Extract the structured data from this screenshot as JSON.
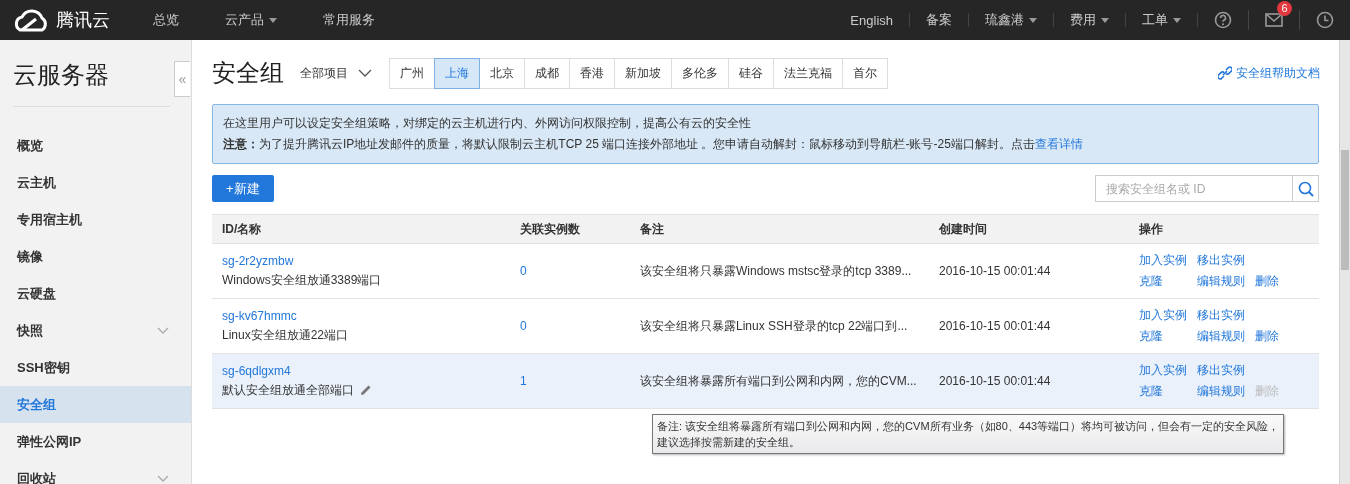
{
  "topbar": {
    "logo": "腾讯云",
    "nav": [
      {
        "label": "总览",
        "dropdown": false
      },
      {
        "label": "云产品",
        "dropdown": true
      },
      {
        "label": "常用服务",
        "dropdown": false
      }
    ],
    "right": [
      {
        "label": "English",
        "dropdown": false
      },
      {
        "label": "备案",
        "dropdown": false
      },
      {
        "label": "琉鑫港",
        "dropdown": true
      },
      {
        "label": "费用",
        "dropdown": true
      },
      {
        "label": "工单",
        "dropdown": true
      }
    ],
    "mail_badge": "6"
  },
  "sidebar": {
    "title": "云服务器",
    "collapse": "«",
    "items": [
      {
        "label": "概览",
        "selected": false,
        "expandable": false
      },
      {
        "label": "云主机",
        "selected": false,
        "expandable": false
      },
      {
        "label": "专用宿主机",
        "selected": false,
        "expandable": false
      },
      {
        "label": "镜像",
        "selected": false,
        "expandable": false
      },
      {
        "label": "云硬盘",
        "selected": false,
        "expandable": false
      },
      {
        "label": "快照",
        "selected": false,
        "expandable": true
      },
      {
        "label": "SSH密钥",
        "selected": false,
        "expandable": false
      },
      {
        "label": "安全组",
        "selected": true,
        "expandable": false
      },
      {
        "label": "弹性公网IP",
        "selected": false,
        "expandable": false
      },
      {
        "label": "回收站",
        "selected": false,
        "expandable": true
      }
    ]
  },
  "page": {
    "title": "安全组",
    "project": "全部项目",
    "regions": [
      {
        "label": "广州",
        "selected": false
      },
      {
        "label": "上海",
        "selected": true
      },
      {
        "label": "北京",
        "selected": false
      },
      {
        "label": "成都",
        "selected": false
      },
      {
        "label": "香港",
        "selected": false
      },
      {
        "label": "新加坡",
        "selected": false
      },
      {
        "label": "多伦多",
        "selected": false
      },
      {
        "label": "硅谷",
        "selected": false
      },
      {
        "label": "法兰克福",
        "selected": false
      },
      {
        "label": "首尔",
        "selected": false
      }
    ],
    "help_link": "安全组帮助文档",
    "notice": {
      "line1": "在这里用户可以设定安全组策略，对绑定的云主机进行内、外网访问权限控制，提高公有云的安全性",
      "line2": "**注意：**为了提升腾讯云IP地址发邮件的质量，将默认限制云主机TCP 25 端口连接外部地址 。您申请自动解封：鼠标移动到导航栏-账号-25端口解封。点击",
      "link": "查看详情"
    },
    "new_button": "+新建",
    "search": {
      "placeholder": "搜索安全组名或 ID"
    }
  },
  "table": {
    "columns": [
      "ID/名称",
      "关联实例数",
      "备注",
      "创建时间",
      "操作"
    ],
    "rows": [
      {
        "id": "sg-2r2yzmbw",
        "name": "Windows安全组放通3389端口",
        "instances": "0",
        "remark": "该安全组将只暴露Windows mstsc登录的tcp 3389...",
        "created": "2016-10-15 00:01:44",
        "highlighted": false,
        "actions": [
          {
            "label": "加入实例",
            "disabled": false
          },
          {
            "label": "移出实例",
            "disabled": false
          },
          {
            "label": "克隆",
            "disabled": false
          },
          {
            "label": "编辑规则",
            "disabled": false
          },
          {
            "label": "删除",
            "disabled": false
          }
        ]
      },
      {
        "id": "sg-kv67hmmc",
        "name": "Linux安全组放通22端口",
        "instances": "0",
        "remark": "该安全组将只暴露Linux SSH登录的tcp 22端口到...",
        "created": "2016-10-15 00:01:44",
        "highlighted": false,
        "actions": [
          {
            "label": "加入实例",
            "disabled": false
          },
          {
            "label": "移出实例",
            "disabled": false
          },
          {
            "label": "克隆",
            "disabled": false
          },
          {
            "label": "编辑规则",
            "disabled": false
          },
          {
            "label": "删除",
            "disabled": false
          }
        ]
      },
      {
        "id": "sg-6qdlgxm4",
        "name": "默认安全组放通全部端口",
        "instances": "1",
        "remark": "该安全组将暴露所有端口到公网和内网，您的CVM...",
        "created": "2016-10-15 00:01:44",
        "highlighted": true,
        "actions": [
          {
            "label": "加入实例",
            "disabled": false
          },
          {
            "label": "移出实例",
            "disabled": false
          },
          {
            "label": "克隆",
            "disabled": false
          },
          {
            "label": "编辑规则",
            "disabled": false
          },
          {
            "label": "删除",
            "disabled": true
          }
        ]
      }
    ],
    "tooltip": {
      "lines": [
        "备注: 该安全组将暴露所有端口到公网和内网，您的CVM所有业务（如80、443等端口）将均可被访问，但会有一定的安全风险，",
        "建议选择按需新建的安全组。"
      ]
    }
  }
}
